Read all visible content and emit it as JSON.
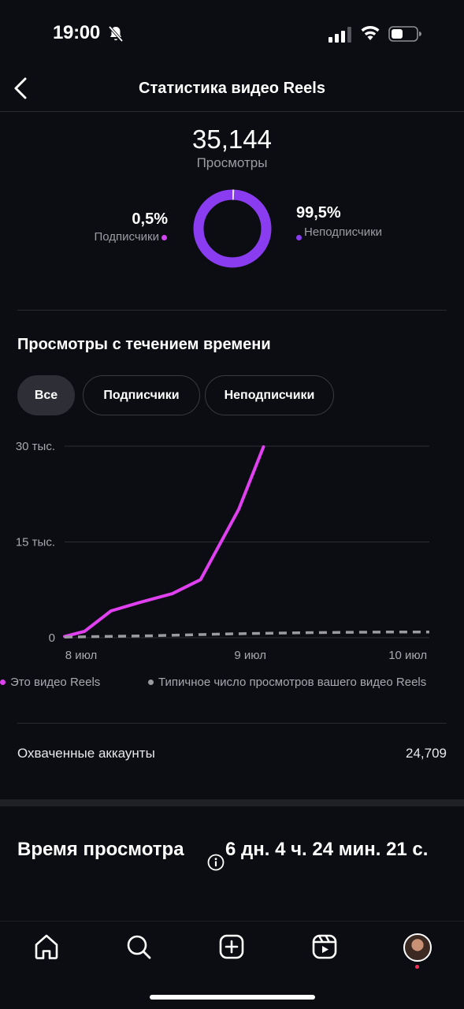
{
  "status_bar": {
    "time": "19:00",
    "icons": [
      "bell-slash-icon",
      "cellular-signal-icon",
      "wifi-icon",
      "battery-icon"
    ]
  },
  "header": {
    "title": "Статистика видео Reels",
    "back_icon": "chevron-left-icon"
  },
  "summary": {
    "total": "35,144",
    "total_label": "Просмотры",
    "subscribers_pct": "0,5%",
    "subscribers_label": "Подписчики",
    "nonsubscribers_pct": "99,5%",
    "nonsubscribers_label": "Неподписчики",
    "subscribers_share": 0.005,
    "colors": {
      "subscribers": "#d245f0",
      "nonsubscribers": "#8a3df0"
    }
  },
  "views_over_time": {
    "title": "Просмотры с течением времени",
    "filters": [
      "Все",
      "Подписчики",
      "Неподписчики"
    ],
    "active_filter": "Все"
  },
  "chart_data": {
    "type": "line",
    "x_tick_labels": [
      "8 июл",
      "9 июл",
      "10 июл"
    ],
    "y_tick_labels": [
      "30 тыс.",
      "15 тыс.",
      "0"
    ],
    "ylim": [
      0,
      30000
    ],
    "xlim": [
      0,
      2.2
    ],
    "series": [
      {
        "name": "Это видео Reels",
        "color": "#e040f0",
        "style": "solid",
        "x": [
          0,
          0.12,
          0.28,
          0.45,
          0.65,
          0.82,
          1.05,
          1.2
        ],
        "values": [
          200,
          1000,
          4200,
          5500,
          6900,
          9100,
          20100,
          29900
        ]
      },
      {
        "name": "Типичное число просмотров вашего видео Reels",
        "color": "#9a9aa0",
        "style": "dashed",
        "x": [
          0,
          0.5,
          1.0,
          1.5,
          2.0,
          2.2
        ],
        "values": [
          100,
          300,
          600,
          800,
          900,
          900
        ]
      }
    ],
    "grid": true,
    "legend": "bottom"
  },
  "reach": {
    "label": "Охваченные аккаунты",
    "value": "24,709"
  },
  "watch_time": {
    "title": "Время просмотра",
    "value": "6 дн. 4 ч. 24 мин. 21 с.",
    "info_icon": "info-icon"
  },
  "tab_bar": {
    "tabs": [
      "home-icon",
      "search-icon",
      "create-icon",
      "reels-icon",
      "profile-avatar"
    ]
  }
}
